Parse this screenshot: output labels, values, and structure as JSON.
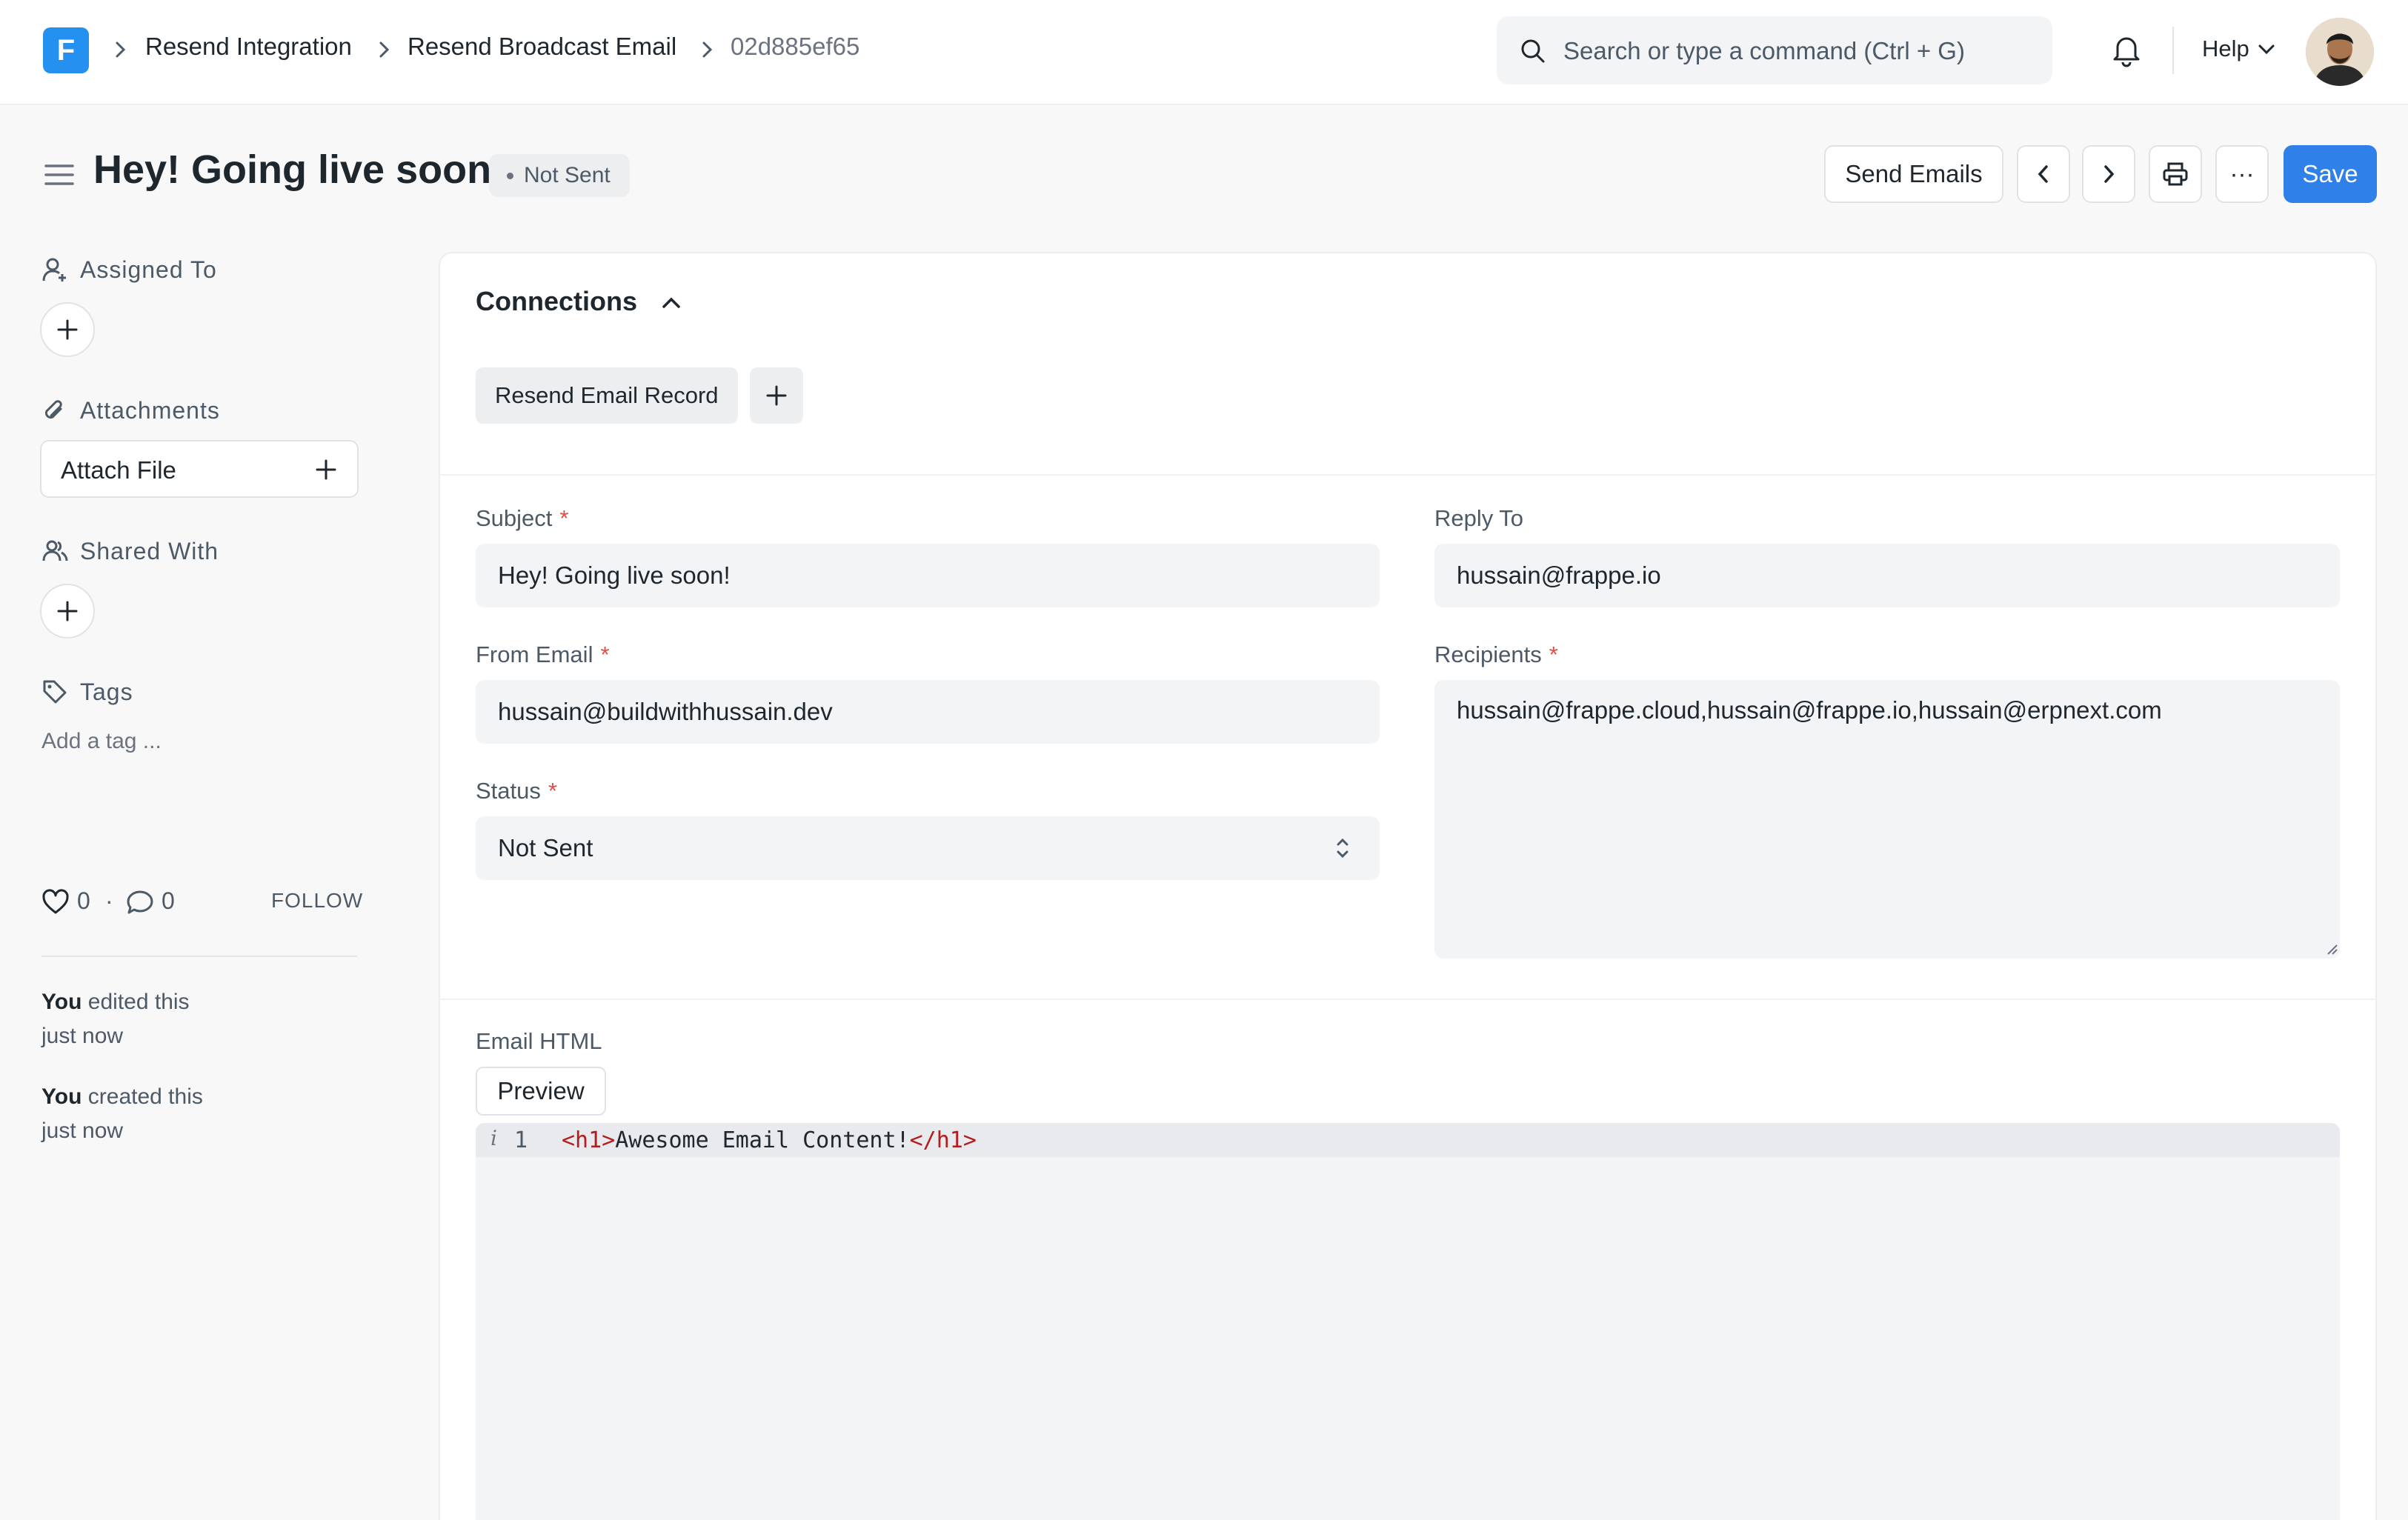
{
  "app": {
    "logo_letter": "F",
    "accent": "#2490ef"
  },
  "breadcrumbs": [
    "Resend Integration",
    "Resend Broadcast Email",
    "02d885ef65"
  ],
  "search": {
    "placeholder": "Search or type a command (Ctrl + G)"
  },
  "navbar": {
    "help_label": "Help"
  },
  "page": {
    "title": "Hey! Going live soon!",
    "status": "Not Sent"
  },
  "actions": {
    "send_emails": "Send Emails",
    "more": "···",
    "save": "Save"
  },
  "sidebar": {
    "assigned_to": "Assigned To",
    "attachments": "Attachments",
    "attach_file": "Attach File",
    "shared_with": "Shared With",
    "tags": "Tags",
    "add_tag": "Add a tag ...",
    "likes": "0",
    "comments": "0",
    "dot": "·",
    "follow": "FOLLOW",
    "activity": [
      {
        "who": "You",
        "text": "edited this",
        "when": "just now"
      },
      {
        "who": "You",
        "text": "created this",
        "when": "just now"
      }
    ]
  },
  "connections": {
    "title": "Connections",
    "items": [
      "Resend Email Record"
    ]
  },
  "form": {
    "subject_label": "Subject",
    "subject_value": "Hey! Going live soon!",
    "reply_to_label": "Reply To",
    "reply_to_value": "hussain@frappe.io",
    "from_email_label": "From Email",
    "from_email_value": "hussain@buildwithhussain.dev",
    "recipients_label": "Recipients",
    "recipients_value": "hussain@frappe.cloud,hussain@frappe.io,hussain@erpnext.com",
    "status_label": "Status",
    "status_value": "Not Sent",
    "required_mark": "*",
    "email_html_label": "Email HTML",
    "preview_button": "Preview"
  },
  "editor": {
    "info_glyph": "i",
    "line_number": "1",
    "open_tag": "<h1>",
    "content": "Awesome Email Content!",
    "close_tag": "</h1>"
  }
}
